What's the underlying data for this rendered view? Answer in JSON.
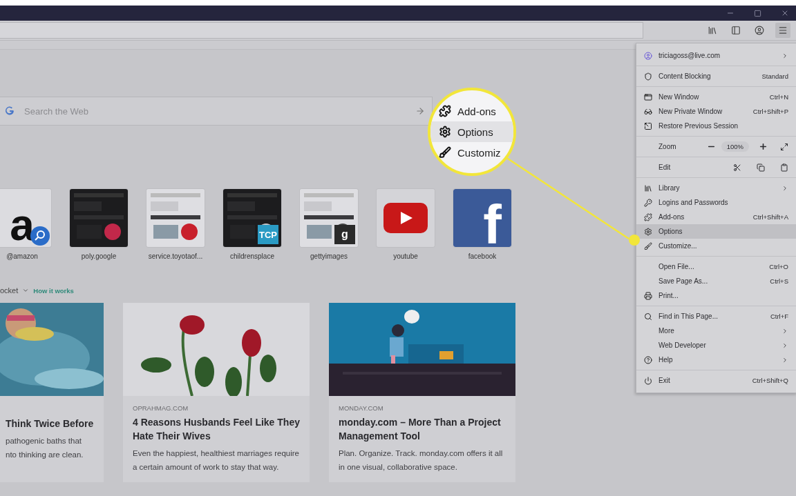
{
  "search": {
    "placeholder": "Search the Web"
  },
  "top_sites": [
    {
      "label": "@amazon",
      "kind": "letter",
      "logo": "a"
    },
    {
      "label": "poly.google",
      "kind": "screenshot"
    },
    {
      "label": "service.toyotaof...",
      "kind": "screenshot"
    },
    {
      "label": "childrensplace",
      "kind": "screenshot",
      "badge": "TCP"
    },
    {
      "label": "gettyimages",
      "kind": "screenshot",
      "badge": "g"
    },
    {
      "label": "youtube",
      "kind": "video"
    },
    {
      "label": "facebook",
      "kind": "tile",
      "logo": "f"
    }
  ],
  "pocket": {
    "title": "ocket",
    "link": "How it works"
  },
  "stories": [
    {
      "title": "Think Twice Before",
      "excerpt": "pathogenic baths that\nnto thinking are clean."
    },
    {
      "source": "OPRAHMAG.COM",
      "title": "4 Reasons Husbands Feel Like They Hate Their Wives",
      "excerpt": "Even the happiest, healthiest marriages require a certain amount of work to stay that way."
    },
    {
      "source": "MONDAY.COM",
      "title": "monday.com – More Than a Project Management Tool",
      "excerpt": "Plan. Organize. Track. monday.com offers it all in one visual, collaborative space."
    }
  ],
  "menu": {
    "sections": [
      [
        {
          "kind": "item",
          "label": "triciagoss@live.com",
          "submenu": true,
          "selected": false
        }
      ],
      [
        {
          "kind": "item",
          "label": "Content Blocking",
          "value": "Standard",
          "selected": false
        }
      ],
      [
        {
          "kind": "item",
          "label": "New Window",
          "shortcut": "Ctrl+N",
          "selected": false
        },
        {
          "kind": "item",
          "label": "New Private Window",
          "shortcut": "Ctrl+Shift+P",
          "selected": false
        },
        {
          "kind": "item",
          "label": "Restore Previous Session",
          "selected": false
        }
      ],
      [
        {
          "kind": "zoom",
          "label": "Zoom",
          "value": "100%"
        }
      ],
      [
        {
          "kind": "edit",
          "label": "Edit"
        }
      ],
      [
        {
          "kind": "item",
          "label": "Library",
          "submenu": true,
          "selected": false
        },
        {
          "kind": "item",
          "label": "Logins and Passwords",
          "selected": false
        },
        {
          "kind": "item",
          "label": "Add-ons",
          "shortcut": "Ctrl+Shift+A",
          "selected": false
        },
        {
          "kind": "item",
          "label": "Options",
          "selected": true
        },
        {
          "kind": "item",
          "label": "Customize...",
          "selected": false
        }
      ],
      [
        {
          "kind": "item",
          "label": "Open File...",
          "shortcut": "Ctrl+O",
          "selected": false
        },
        {
          "kind": "item",
          "label": "Save Page As...",
          "shortcut": "Ctrl+S",
          "selected": false
        },
        {
          "kind": "item",
          "label": "Print...",
          "selected": false
        }
      ],
      [
        {
          "kind": "item",
          "label": "Find in This Page...",
          "shortcut": "Ctrl+F",
          "selected": false
        },
        {
          "kind": "item",
          "label": "More",
          "submenu": true,
          "selected": false
        },
        {
          "kind": "item",
          "label": "Web Developer",
          "submenu": true,
          "selected": false
        },
        {
          "kind": "item",
          "label": "Help",
          "submenu": true,
          "selected": false
        }
      ],
      [
        {
          "kind": "item",
          "label": "Exit",
          "shortcut": "Ctrl+Shift+Q",
          "selected": false
        }
      ]
    ]
  },
  "magnifier": {
    "items": [
      {
        "label": "Add-ons",
        "selected": false
      },
      {
        "label": "Options",
        "selected": true
      },
      {
        "label": "Customiz",
        "selected": false
      }
    ]
  }
}
